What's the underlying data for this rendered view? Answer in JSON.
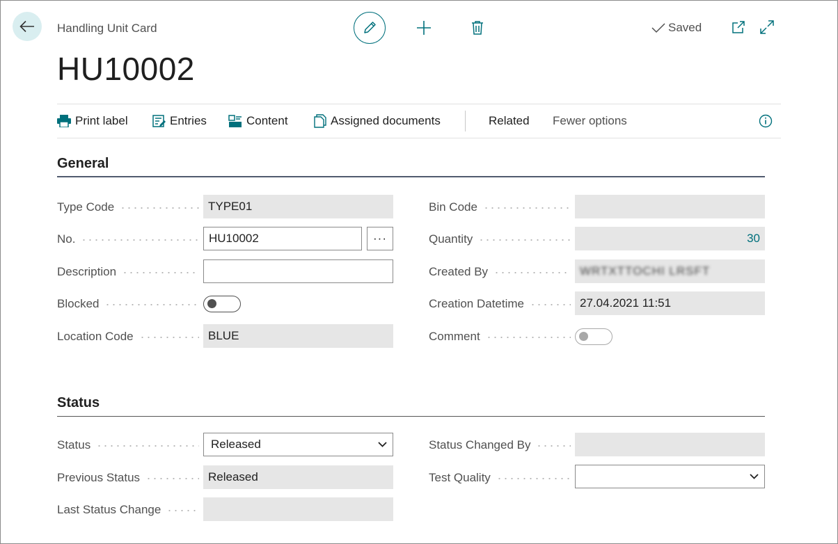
{
  "header": {
    "breadcrumb": "Handling Unit Card",
    "title": "HU10002",
    "saved_label": "Saved"
  },
  "actions": [
    {
      "label": "Print label",
      "icon": "printer-icon"
    },
    {
      "label": "Entries",
      "icon": "entries-icon"
    },
    {
      "label": "Content",
      "icon": "content-icon"
    },
    {
      "label": "Assigned documents",
      "icon": "documents-icon"
    },
    {
      "label": "Related",
      "icon": ""
    },
    {
      "label": "Fewer options",
      "icon": ""
    }
  ],
  "general": {
    "title": "General",
    "type_code": {
      "label": "Type Code",
      "value": "TYPE01"
    },
    "no": {
      "label": "No.",
      "value": "HU10002",
      "lookup_label": "···"
    },
    "description": {
      "label": "Description",
      "value": ""
    },
    "blocked": {
      "label": "Blocked",
      "value": false
    },
    "location_code": {
      "label": "Location Code",
      "value": "BLUE"
    },
    "bin_code": {
      "label": "Bin Code",
      "value": ""
    },
    "quantity": {
      "label": "Quantity",
      "value": "30"
    },
    "created_by": {
      "label": "Created By",
      "value": "WRTXTTOCHI LRSFT"
    },
    "creation_datetime": {
      "label": "Creation Datetime",
      "value": "27.04.2021 11:51"
    },
    "comment": {
      "label": "Comment",
      "value": false
    }
  },
  "status": {
    "title": "Status",
    "status": {
      "label": "Status",
      "value": "Released"
    },
    "previous_status": {
      "label": "Previous Status",
      "value": "Released"
    },
    "last_status_change": {
      "label": "Last Status Change",
      "value": ""
    },
    "status_changed_by": {
      "label": "Status Changed By",
      "value": ""
    },
    "test_quality": {
      "label": "Test Quality",
      "value": ""
    }
  },
  "colors": {
    "accent": "#00707c",
    "readonly_bg": "#e6e6e6",
    "back_bg": "#d9eef0"
  }
}
